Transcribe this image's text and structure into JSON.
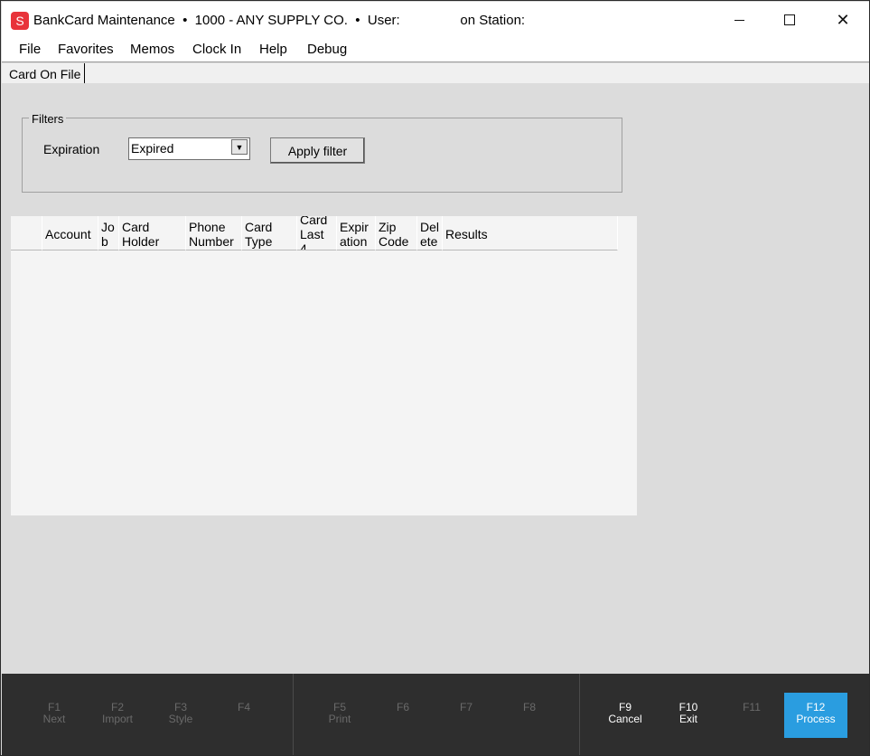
{
  "window": {
    "title": "BankCard Maintenance  •  1000 - ANY SUPPLY CO.  •  User:                on Station:",
    "app_icon_letter": "S"
  },
  "menu": [
    "File",
    "Favorites",
    "Memos",
    "Clock In",
    "Help",
    "Debug"
  ],
  "tab": {
    "label": "Card On File"
  },
  "filters": {
    "legend": "Filters",
    "expiration_label": "Expiration",
    "expiration_value": "Expired",
    "apply_label": "Apply filter"
  },
  "grid": {
    "columns": [
      "",
      "Account",
      "Jo b",
      "Card Holder",
      "Phone Number",
      "Card Type",
      "Card Last 4",
      "Expir ation",
      "Zip Code",
      "Del ete",
      "Results"
    ],
    "rows": []
  },
  "fkeys": [
    {
      "key": "F1",
      "label": "Next",
      "enabled": false
    },
    {
      "key": "F2",
      "label": "Import",
      "enabled": false
    },
    {
      "key": "F3",
      "label": "Style",
      "enabled": false
    },
    {
      "key": "F4",
      "label": "",
      "enabled": false
    },
    {
      "key": "F5",
      "label": "Print",
      "enabled": false
    },
    {
      "key": "F6",
      "label": "",
      "enabled": false
    },
    {
      "key": "F7",
      "label": "",
      "enabled": false
    },
    {
      "key": "F8",
      "label": "",
      "enabled": false
    },
    {
      "key": "F9",
      "label": "Cancel",
      "enabled": true
    },
    {
      "key": "F10",
      "label": "Exit",
      "enabled": true
    },
    {
      "key": "F11",
      "label": "",
      "enabled": false
    },
    {
      "key": "F12",
      "label": "Process",
      "enabled": true
    }
  ],
  "colors": {
    "primary_key": "#2a9de0",
    "fkey_bar": "#2e2e2e",
    "app_icon": "#e8333a"
  }
}
